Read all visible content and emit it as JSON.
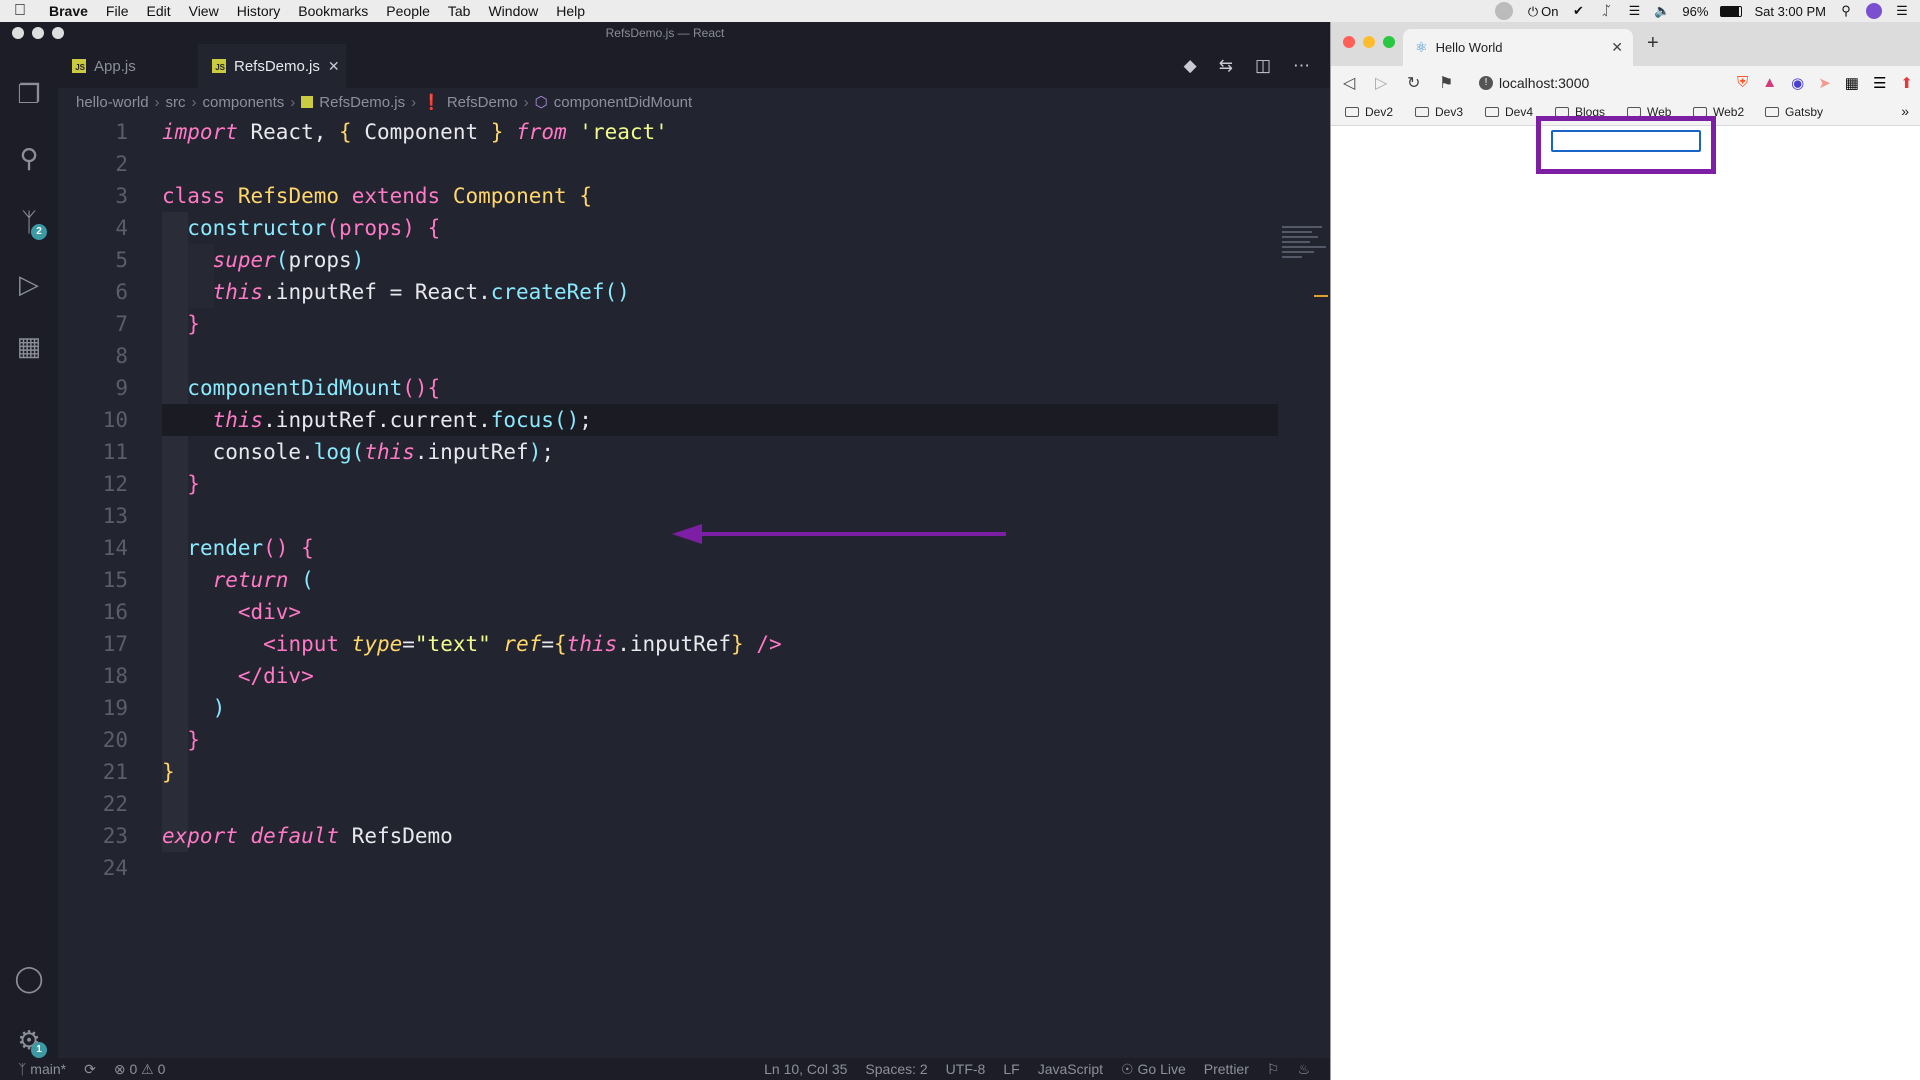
{
  "menubar": {
    "app": "Brave",
    "items": [
      "File",
      "Edit",
      "View",
      "History",
      "Bookmarks",
      "People",
      "Tab",
      "Window",
      "Help"
    ],
    "focus_label": "On",
    "battery": "96%",
    "clock": "Sat 3:00 PM"
  },
  "vscode": {
    "window_title": "RefsDemo.js — React",
    "tabs": [
      {
        "label": "App.js",
        "active": false
      },
      {
        "label": "RefsDemo.js",
        "active": true
      }
    ],
    "breadcrumb": [
      "hello-world",
      "src",
      "components",
      "RefsDemo.js",
      "RefsDemo",
      "componentDidMount"
    ],
    "source_control_badge": "2",
    "settings_badge": "1",
    "highlighted_line": 10,
    "lines": [
      "1",
      "2",
      "3",
      "4",
      "5",
      "6",
      "7",
      "8",
      "9",
      "10",
      "11",
      "12",
      "13",
      "14",
      "15",
      "16",
      "17",
      "18",
      "19",
      "20",
      "21",
      "22",
      "23",
      "24"
    ],
    "status": {
      "branch": "main*",
      "problems": "0 ⚠ 0",
      "position": "Ln 10, Col 35",
      "spaces": "Spaces: 2",
      "encoding": "UTF-8",
      "eol": "LF",
      "language": "JavaScript",
      "golive": "Go Live",
      "prettier": "Prettier"
    }
  },
  "browser": {
    "tab_title": "Hello World",
    "url": "localhost:3000",
    "bookmarks": [
      "Dev2",
      "Dev3",
      "Dev4",
      "Blogs",
      "Web",
      "Web2",
      "Gatsby"
    ],
    "input_value": ""
  },
  "colors": {
    "annotation": "#7d1fa5",
    "editor_bg": "#22242f"
  }
}
